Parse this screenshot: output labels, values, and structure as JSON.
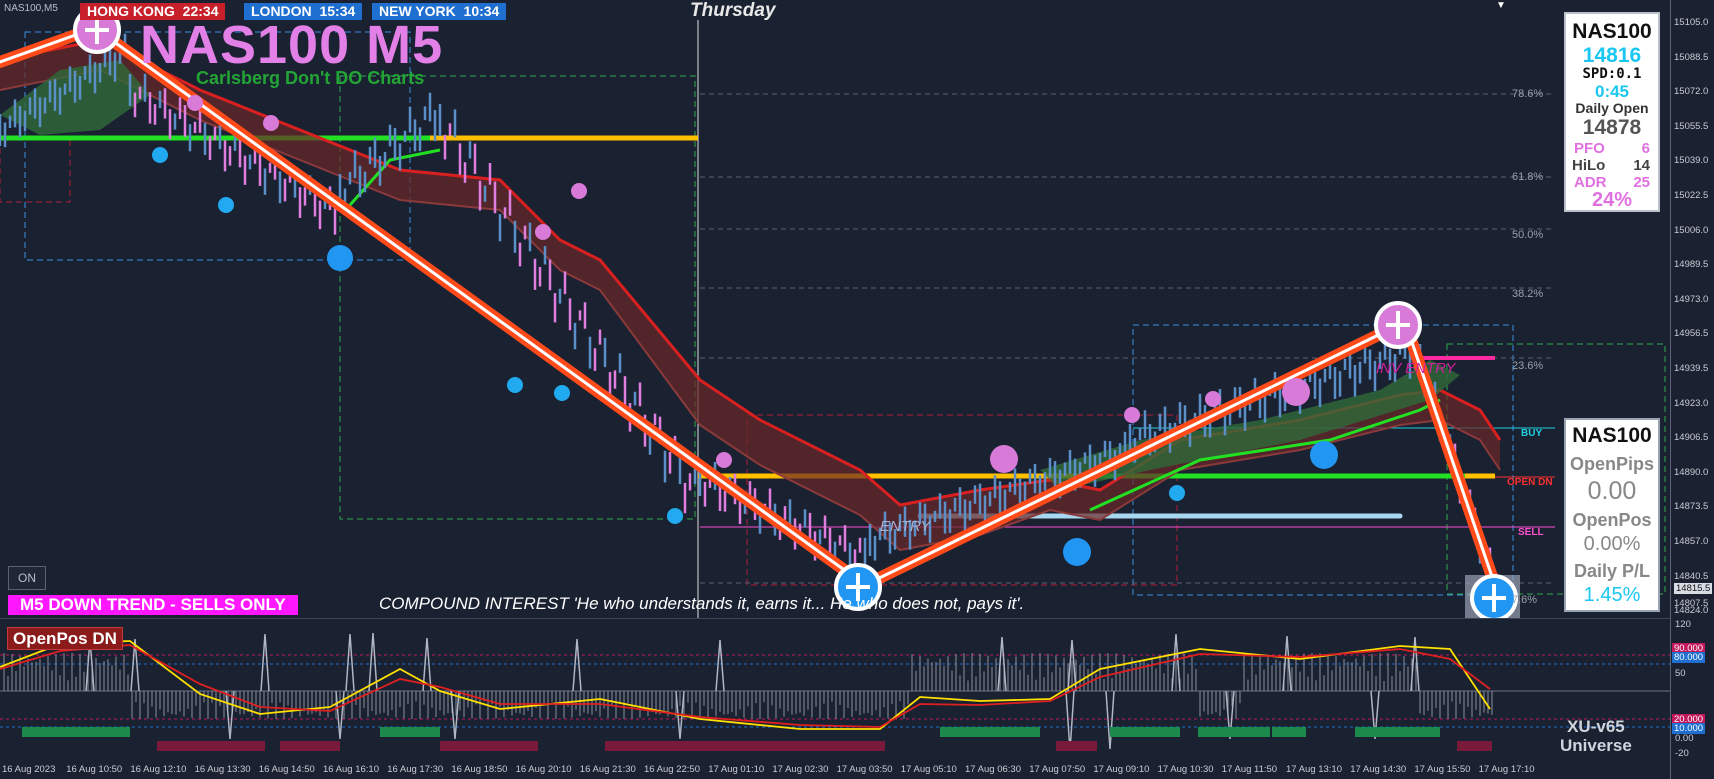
{
  "chart_symbol": "NAS100,M5",
  "sessions": [
    {
      "name": "HONG KONG",
      "time": "22:34",
      "color": "#c8202a"
    },
    {
      "name": "LONDON",
      "time": "15:34",
      "color": "#1e6fd0"
    },
    {
      "name": "NEW YORK",
      "time": "10:34",
      "color": "#1e6fd0"
    }
  ],
  "title": "NAS100 M5",
  "subtitle": "Carlsberg Don't DO Charts",
  "day_label": "Thursday",
  "fib_levels": [
    "78.6%",
    "61.8%",
    "50.0%",
    "38.2%",
    "23.6%",
    "7.6%"
  ],
  "level_labels": {
    "buy": "BUY",
    "open_dn": "OPEN DN",
    "sell": "SELL"
  },
  "entry_labels": [
    "INV ENTRY",
    "ENTRY"
  ],
  "on_button": "ON",
  "trend_banner": "M5  DOWN TREND - SELLS ONLY",
  "compound_text": "COMPOUND INTEREST 'He who understands it, earns it... He who does not, pays it'.",
  "info_panel": {
    "symbol": "NAS100",
    "price": "14816",
    "spread": "SPD:0.1",
    "timer": "0:45",
    "daily_open_label": "Daily Open",
    "daily_open": "14878",
    "pfo_label": "PFO",
    "pfo": "6",
    "hilo_label": "HiLo",
    "hilo": "14",
    "adr_label": "ADR",
    "adr": "25",
    "adr_pct": "24%"
  },
  "pos_panel": {
    "symbol": "NAS100",
    "open_pips_label": "OpenPips",
    "open_pips": "0.00",
    "open_pos_label": "OpenPos",
    "open_pos": "0.00%",
    "daily_pl_label": "Daily P/L",
    "daily_pl": "1.45%"
  },
  "oscillator": {
    "label": "OpenPos DN",
    "brand_line1": "XU-v65",
    "brand_line2": "Universe",
    "ticks": [
      "120",
      "50",
      "0.00",
      "-20"
    ],
    "tags": [
      {
        "text": "90.000",
        "color": "#c2185b"
      },
      {
        "text": "80.000",
        "color": "#1e6fd0"
      },
      {
        "text": "20.000",
        "color": "#c2185b"
      },
      {
        "text": "10.000",
        "color": "#1e6fd0"
      }
    ]
  },
  "price_axis": [
    "15105.0",
    "15088.5",
    "15072.0",
    "15055.5",
    "15039.0",
    "15022.5",
    "15006.0",
    "14989.5",
    "14973.0",
    "14956.5",
    "14939.5",
    "14923.0",
    "14906.5",
    "14890.0",
    "14873.5",
    "14857.0",
    "14840.5",
    "14824.0",
    "14815.5",
    "14807.5"
  ],
  "dates": [
    "16 Aug 2023",
    "16 Aug 10:50",
    "16 Aug 12:10",
    "16 Aug 13:30",
    "16 Aug 14:50",
    "16 Aug 16:10",
    "16 Aug 17:30",
    "16 Aug 18:50",
    "16 Aug 20:10",
    "16 Aug 21:30",
    "16 Aug 22:50",
    "17 Aug 01:10",
    "17 Aug 02:30",
    "17 Aug 03:50",
    "17 Aug 05:10",
    "17 Aug 06:30",
    "17 Aug 07:50",
    "17 Aug 09:10",
    "17 Aug 10:30",
    "17 Aug 11:50",
    "17 Aug 13:10",
    "17 Aug 14:30",
    "17 Aug 15:50",
    "17 Aug 17:10"
  ],
  "colors": {
    "bull": "#5b8fc8",
    "bear": "#e07ee0",
    "gold": "#ffc000",
    "green": "#22e022",
    "trend": "#ff4a1a"
  }
}
